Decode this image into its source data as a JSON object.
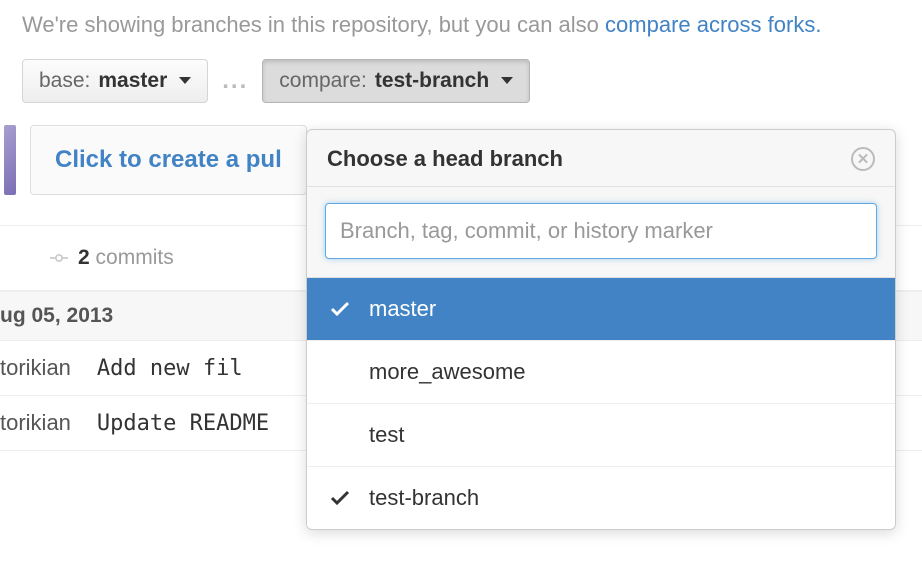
{
  "banner": {
    "text_prefix": "We're showing branches in this repository, but you can also ",
    "link_text": "compare across forks."
  },
  "selectors": {
    "base_label": "base:",
    "base_value": "master",
    "separator": "...",
    "compare_label": "compare:",
    "compare_value": "test-branch"
  },
  "create_pr_button": "Click to create a pul",
  "commits": {
    "count": "2",
    "label": "commits"
  },
  "date_header": "ug 05, 2013",
  "commit_rows": [
    {
      "author": "torikian",
      "message": "Add new fil"
    },
    {
      "author": "torikian",
      "message": "Update README"
    }
  ],
  "popover": {
    "title": "Choose a head branch",
    "search_placeholder": "Branch, tag, commit, or history marker",
    "branches": [
      {
        "name": "master",
        "selected": true,
        "current": false
      },
      {
        "name": "more_awesome",
        "selected": false,
        "current": false
      },
      {
        "name": "test",
        "selected": false,
        "current": false
      },
      {
        "name": "test-branch",
        "selected": false,
        "current": true
      }
    ]
  }
}
